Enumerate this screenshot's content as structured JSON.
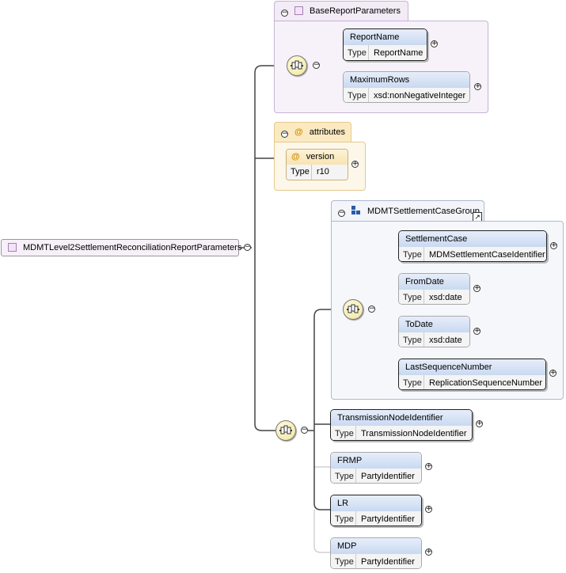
{
  "root": {
    "name": "MDMTLevel2SettlementReconciliationReportParameters"
  },
  "base_group": {
    "title": "BaseReportParameters",
    "elements": [
      {
        "name": "ReportName",
        "type_label": "Type",
        "type": "ReportName"
      },
      {
        "name": "MaximumRows",
        "type_label": "Type",
        "type": "xsd:nonNegativeInteger"
      }
    ]
  },
  "attributes_group": {
    "title": "attributes",
    "attribute": {
      "symbol": "@",
      "name": "version",
      "type_label": "Type",
      "type": "r10"
    }
  },
  "settlement_group": {
    "title": "MDMTSettlementCaseGroup",
    "elements": [
      {
        "name": "SettlementCase",
        "type_label": "Type",
        "type": "MDMSettlementCaseIdentifier"
      },
      {
        "name": "FromDate",
        "type_label": "Type",
        "type": "xsd:date"
      },
      {
        "name": "ToDate",
        "type_label": "Type",
        "type": "xsd:date"
      },
      {
        "name": "LastSequenceNumber",
        "type_label": "Type",
        "type": "ReplicationSequenceNumber"
      }
    ]
  },
  "bottom_elements": [
    {
      "name": "TransmissionNodeIdentifier",
      "type_label": "Type",
      "type": "TransmissionNodeIdentifier"
    },
    {
      "name": "FRMP",
      "type_label": "Type",
      "type": "PartyIdentifier"
    },
    {
      "name": "LR",
      "type_label": "Type",
      "type": "PartyIdentifier"
    },
    {
      "name": "MDP",
      "type_label": "Type",
      "type": "PartyIdentifier"
    }
  ],
  "icons": {
    "expand": "plus-circle-icon",
    "collapse": "minus-circle-icon",
    "sequence": "sequence-compositor-icon",
    "group": "group-reference-icon",
    "attribute": "attribute-at-icon",
    "link": "link-arrow-icon"
  },
  "colors": {
    "connector": "#4a4a4a",
    "optional_connector": "#c8c8c8",
    "element_header": "#c9d9f1",
    "purple_group": "#f7f2fa",
    "yellow_group": "#fdf7ea",
    "blue_group": "#f5f7fb"
  }
}
